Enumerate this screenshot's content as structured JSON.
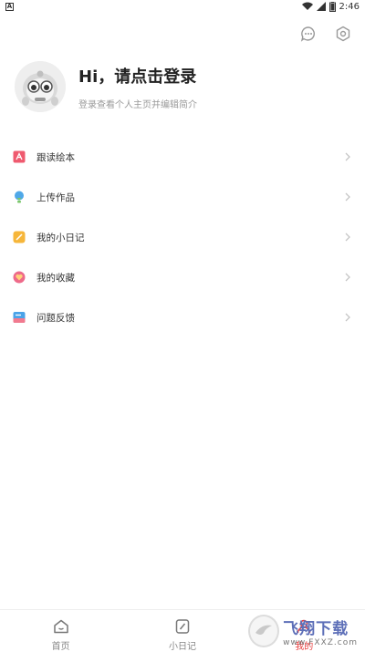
{
  "status_bar": {
    "notification_glyph": "A",
    "time": "2:46"
  },
  "profile": {
    "title": "Hi，请点击登录",
    "subtitle": "登录查看个人主页并编辑简介"
  },
  "menu": {
    "items": [
      {
        "label": "跟读绘本",
        "icon": "picture-book-icon",
        "color": "#ef5a6f"
      },
      {
        "label": "上传作品",
        "icon": "lightbulb-icon",
        "color": "#4fa8e8"
      },
      {
        "label": "我的小日记",
        "icon": "diary-icon",
        "color": "#f6b63a"
      },
      {
        "label": "我的收藏",
        "icon": "favorites-icon",
        "color": "#ee6a8a"
      },
      {
        "label": "问题反馈",
        "icon": "feedback-icon",
        "color": "#4aa3e8"
      }
    ]
  },
  "tabbar": {
    "tabs": [
      {
        "label": "首页",
        "icon": "home-icon",
        "active": false
      },
      {
        "label": "小日记",
        "icon": "diary-tab-icon",
        "active": false
      },
      {
        "label": "我的",
        "icon": "profile-tab-icon",
        "active": true
      }
    ]
  },
  "watermark": {
    "title": "飞翔下载",
    "url": "www.FXXZ.com"
  },
  "colors": {
    "active_tab": "#e83a3a",
    "icon_gray": "#9a9a9a"
  }
}
